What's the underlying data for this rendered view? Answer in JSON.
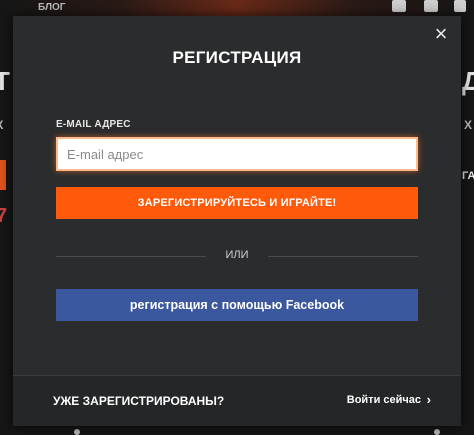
{
  "background": {
    "nav_links": [
      "",
      "БЛОГ"
    ],
    "edge_left_chars": [
      "Т",
      "К",
      "Р",
      "7"
    ],
    "edge_right_chars": [
      "Д",
      "Х",
      "ГА"
    ]
  },
  "modal": {
    "close_label": "×",
    "title": "РЕГИСТРАЦИЯ",
    "email_label": "E-MAIL АДРЕС",
    "email_placeholder": "E-mail адрес",
    "email_value": "",
    "register_button": "ЗАРЕГИСТРИРУЙТЕСЬ И ИГРАЙТЕ!",
    "divider_text": "ИЛИ",
    "facebook_button": "регистрация с помощью Facebook",
    "footer": {
      "question": "УЖЕ ЗАРЕГИСТРИРОВАНЫ?",
      "login_link": "Войти сейчас",
      "chevron": "›"
    }
  },
  "colors": {
    "modal_bg": "#2b2c2d",
    "accent_orange": "#ff5a0a",
    "facebook_blue": "#3b579d"
  }
}
